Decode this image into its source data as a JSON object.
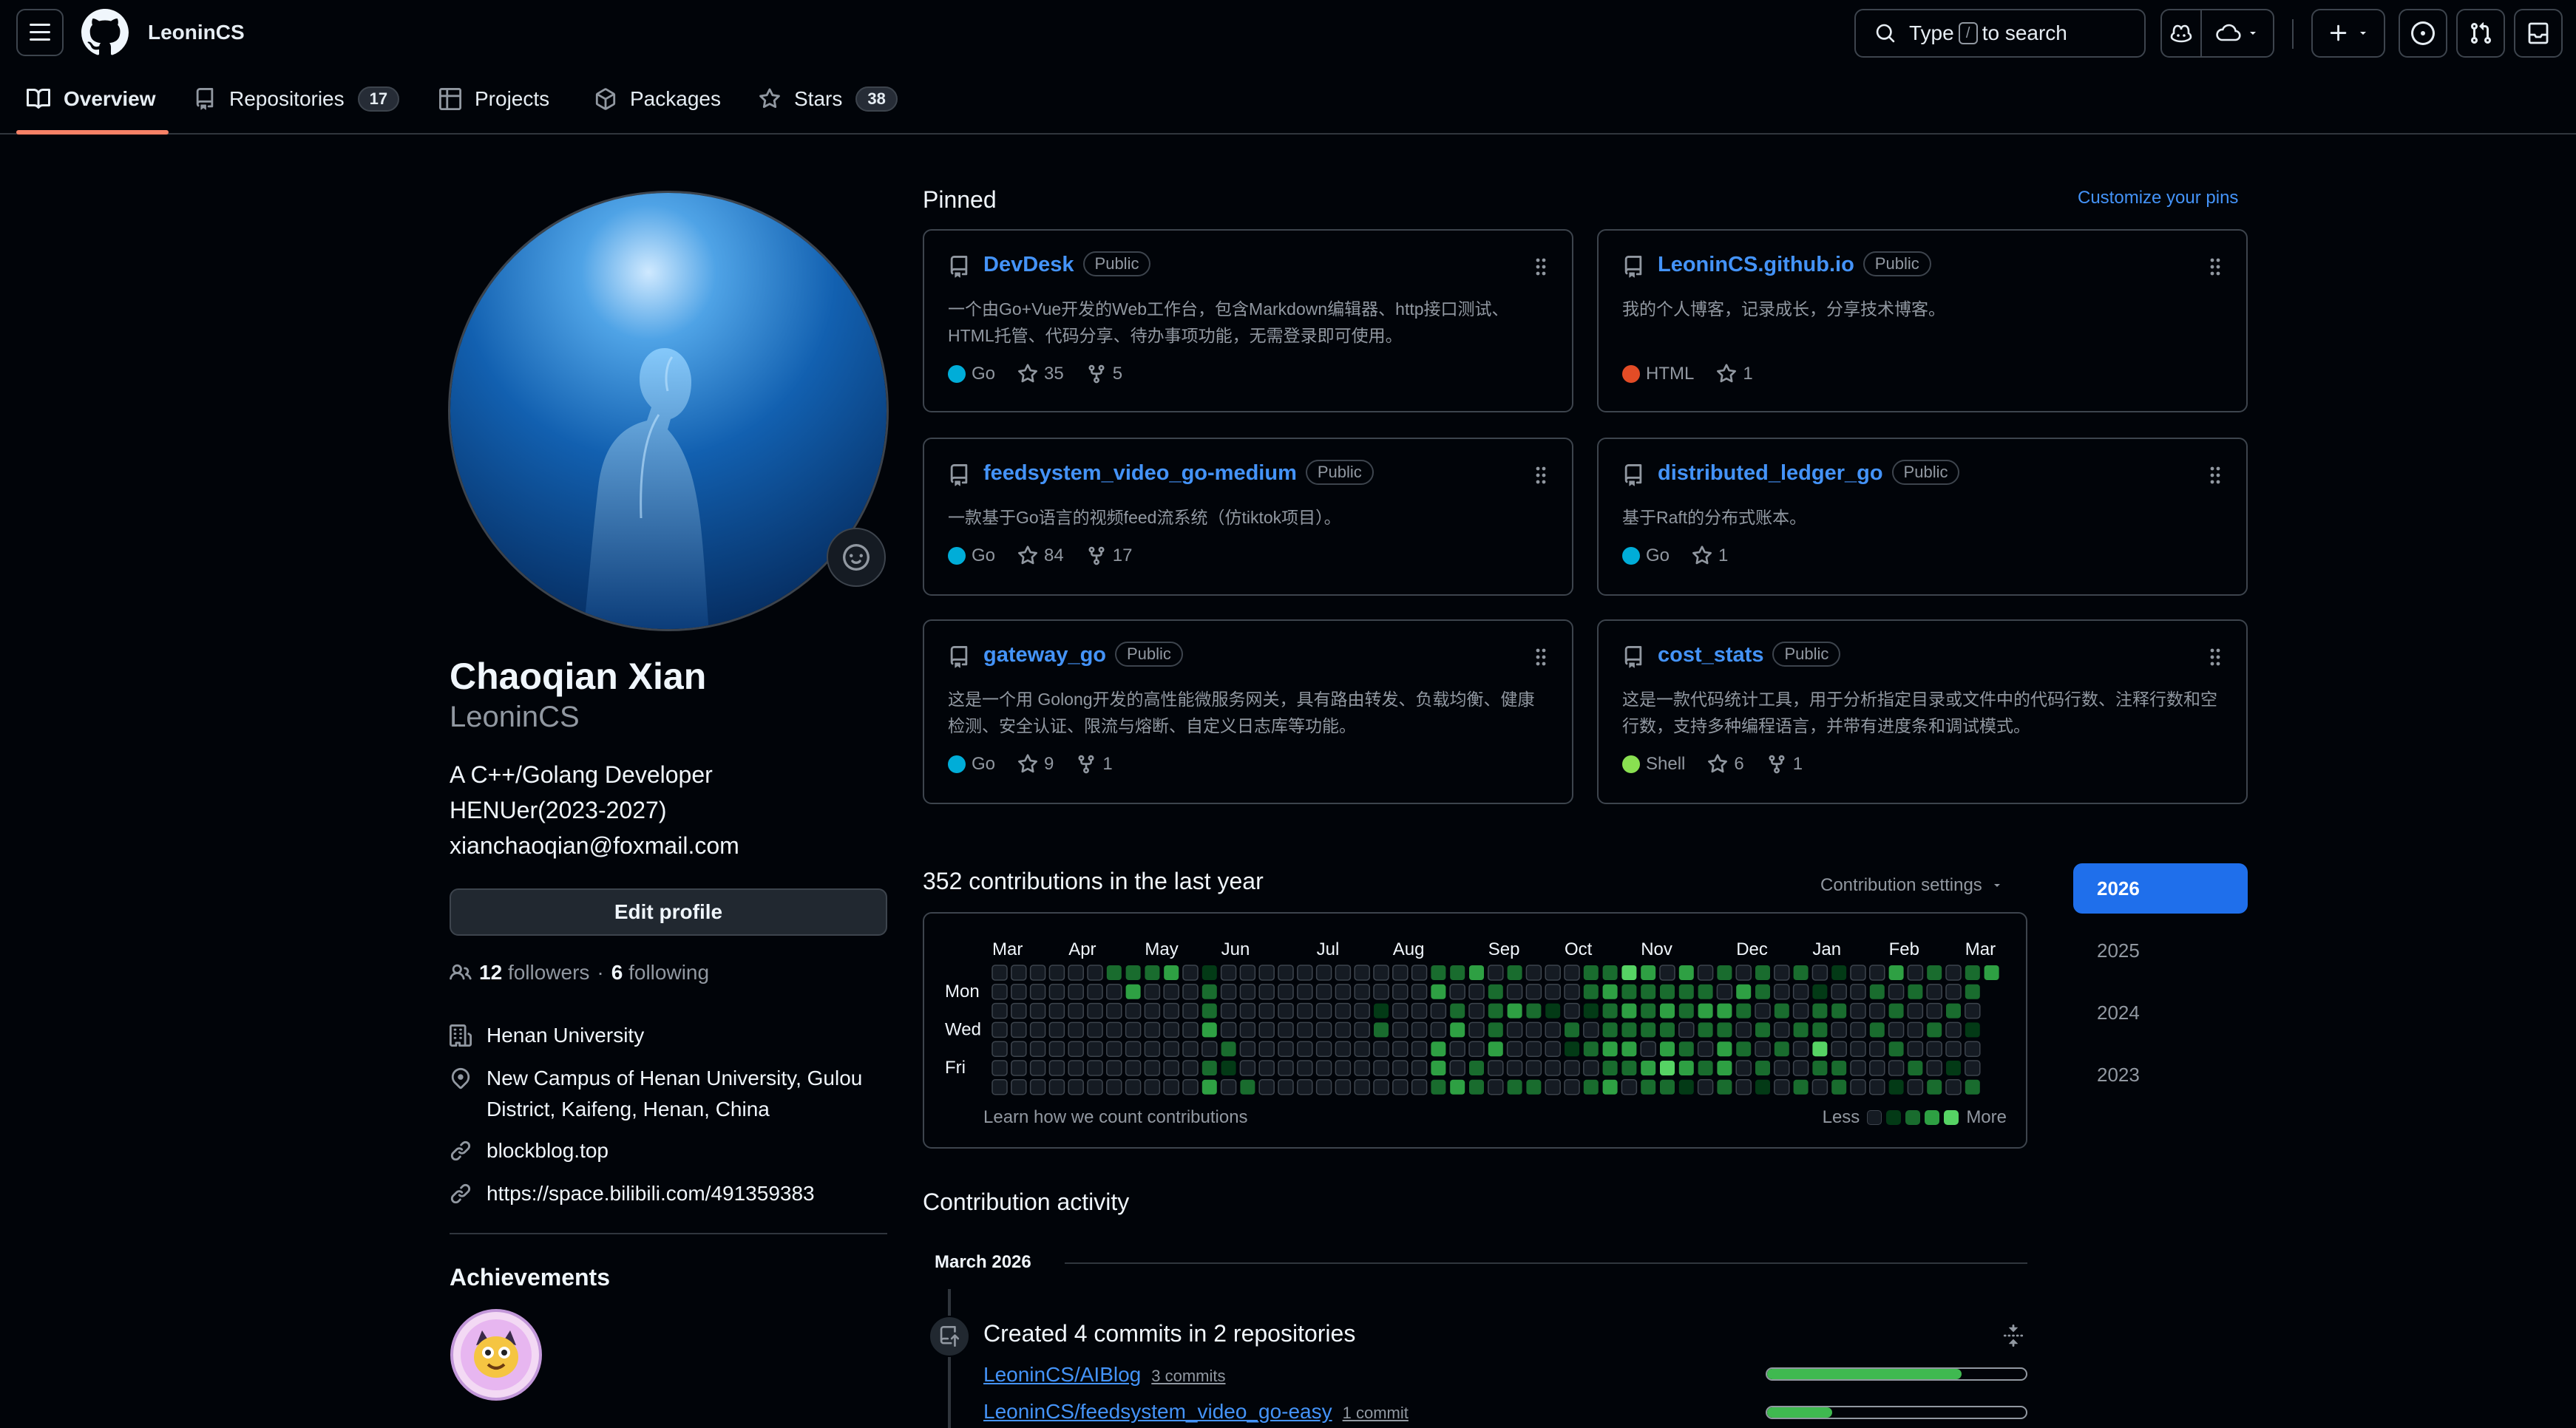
{
  "header": {
    "username": "LeoninCS",
    "search_prefix": "Type",
    "search_key": "/",
    "search_suffix": "to search"
  },
  "tabs": [
    {
      "label": "Overview",
      "count": null
    },
    {
      "label": "Repositories",
      "count": "17"
    },
    {
      "label": "Projects",
      "count": null
    },
    {
      "label": "Packages",
      "count": null
    },
    {
      "label": "Stars",
      "count": "38"
    }
  ],
  "profile": {
    "full_name": "Chaoqian Xian",
    "login": "LeoninCS",
    "bio_lines": [
      "A C++/Golang Developer",
      "HENUer(2023-2027)",
      "xianchaoqian@foxmail.com"
    ],
    "edit_label": "Edit profile",
    "followers": "12",
    "followers_label": "followers",
    "sep": "·",
    "following": "6",
    "following_label": "following",
    "organization": "Henan University",
    "location": "New Campus of Henan University, Gulou District, Kaifeng, Henan, China",
    "blog": "blockblog.top",
    "bilibili": "https://space.bilibili.com/491359383",
    "achievements_title": "Achievements"
  },
  "pinned": {
    "title": "Pinned",
    "customize": "Customize your pins",
    "repos": [
      {
        "name": "DevDesk",
        "visibility": "Public",
        "desc": "一个由Go+Vue开发的Web工作台，包含Markdown编辑器、http接口测试、HTML托管、代码分享、待办事项功能，无需登录即可使用。",
        "lang": "Go",
        "lang_color": "#00add8",
        "stars": "35",
        "forks": "5"
      },
      {
        "name": "LeoninCS.github.io",
        "visibility": "Public",
        "desc": "我的个人博客，记录成长，分享技术博客。",
        "lang": "HTML",
        "lang_color": "#e34c26",
        "stars": "1",
        "forks": null
      },
      {
        "name": "feedsystem_video_go-medium",
        "visibility": "Public",
        "desc": "一款基于Go语言的视频feed流系统（仿tiktok项目）。",
        "lang": "Go",
        "lang_color": "#00add8",
        "stars": "84",
        "forks": "17"
      },
      {
        "name": "distributed_ledger_go",
        "visibility": "Public",
        "desc": "基于Raft的分布式账本。",
        "lang": "Go",
        "lang_color": "#00add8",
        "stars": "1",
        "forks": null
      },
      {
        "name": "gateway_go",
        "visibility": "Public",
        "desc": "这是一个用 Golong开发的高性能微服务网关，具有路由转发、负载均衡、健康检测、安全认证、限流与熔断、自定义日志库等功能。",
        "lang": "Go",
        "lang_color": "#00add8",
        "stars": "9",
        "forks": "1"
      },
      {
        "name": "cost_stats",
        "visibility": "Public",
        "desc": "这是一款代码统计工具，用于分析指定目录或文件中的代码行数、注释行数和空行数，支持多种编程语言，并带有进度条和调试模式。",
        "lang": "Shell",
        "lang_color": "#89e051",
        "stars": "6",
        "forks": "1"
      }
    ]
  },
  "contributions": {
    "title": "352 contributions in the last year",
    "settings_label": "Contribution settings",
    "months": [
      "Mar",
      "Apr",
      "May",
      "Jun",
      "Jul",
      "Aug",
      "Sep",
      "Oct",
      "Nov",
      "Dec",
      "Jan",
      "Feb",
      "Mar"
    ],
    "day_labels": [
      "Mon",
      "Wed",
      "Fri"
    ],
    "learn": "Learn how we count contributions",
    "less": "Less",
    "more": "More",
    "level_colors": [
      "#151b23",
      "#033a16",
      "#196c2e",
      "#2ea043",
      "#56d364"
    ],
    "weeks": 53,
    "active_cells": [
      [
        0,
        6,
        2
      ],
      [
        0,
        7,
        2
      ],
      [
        0,
        8,
        2
      ],
      [
        1,
        7,
        3
      ],
      [
        0,
        9,
        3
      ],
      [
        0,
        11,
        1
      ],
      [
        1,
        11,
        2
      ],
      [
        2,
        11,
        2
      ],
      [
        3,
        11,
        3
      ],
      [
        5,
        11,
        2
      ],
      [
        6,
        11,
        3
      ],
      [
        4,
        12,
        2
      ],
      [
        5,
        12,
        1
      ],
      [
        6,
        13,
        2
      ],
      [
        2,
        20,
        1
      ],
      [
        3,
        20,
        2
      ],
      [
        0,
        23,
        2
      ],
      [
        1,
        23,
        3
      ],
      [
        4,
        23,
        3
      ],
      [
        5,
        23,
        3
      ],
      [
        6,
        23,
        2
      ],
      [
        0,
        24,
        2
      ],
      [
        2,
        24,
        2
      ],
      [
        3,
        24,
        3
      ],
      [
        6,
        24,
        3
      ],
      [
        0,
        25,
        3
      ],
      [
        5,
        25,
        2
      ],
      [
        6,
        25,
        2
      ],
      [
        1,
        26,
        2
      ],
      [
        2,
        26,
        2
      ],
      [
        3,
        26,
        2
      ],
      [
        4,
        26,
        3
      ],
      [
        0,
        27,
        2
      ],
      [
        2,
        27,
        3
      ],
      [
        6,
        27,
        2
      ],
      [
        2,
        28,
        2
      ],
      [
        6,
        28,
        2
      ],
      [
        2,
        29,
        1
      ],
      [
        3,
        30,
        2
      ],
      [
        4,
        30,
        1
      ],
      [
        0,
        31,
        2
      ],
      [
        1,
        31,
        2
      ],
      [
        2,
        31,
        1
      ],
      [
        4,
        31,
        2
      ],
      [
        6,
        31,
        2
      ],
      [
        0,
        32,
        2
      ],
      [
        1,
        32,
        3
      ],
      [
        2,
        32,
        2
      ],
      [
        3,
        32,
        2
      ],
      [
        4,
        32,
        3
      ],
      [
        5,
        32,
        2
      ],
      [
        6,
        32,
        3
      ],
      [
        0,
        33,
        4
      ],
      [
        1,
        33,
        2
      ],
      [
        2,
        33,
        3
      ],
      [
        3,
        33,
        2
      ],
      [
        4,
        33,
        3
      ],
      [
        5,
        33,
        2
      ],
      [
        0,
        34,
        3
      ],
      [
        1,
        34,
        2
      ],
      [
        2,
        34,
        2
      ],
      [
        3,
        34,
        2
      ],
      [
        5,
        34,
        3
      ],
      [
        6,
        34,
        2
      ],
      [
        1,
        35,
        2
      ],
      [
        2,
        35,
        3
      ],
      [
        3,
        35,
        2
      ],
      [
        4,
        35,
        3
      ],
      [
        5,
        35,
        4
      ],
      [
        6,
        35,
        2
      ],
      [
        0,
        36,
        3
      ],
      [
        1,
        36,
        2
      ],
      [
        2,
        36,
        2
      ],
      [
        4,
        36,
        2
      ],
      [
        5,
        36,
        3
      ],
      [
        6,
        36,
        1
      ],
      [
        1,
        37,
        2
      ],
      [
        2,
        37,
        3
      ],
      [
        3,
        37,
        2
      ],
      [
        5,
        37,
        2
      ],
      [
        0,
        38,
        2
      ],
      [
        2,
        38,
        3
      ],
      [
        3,
        38,
        2
      ],
      [
        4,
        38,
        3
      ],
      [
        5,
        38,
        3
      ],
      [
        6,
        38,
        2
      ],
      [
        1,
        39,
        3
      ],
      [
        2,
        39,
        2
      ],
      [
        4,
        39,
        2
      ],
      [
        0,
        40,
        2
      ],
      [
        1,
        40,
        2
      ],
      [
        3,
        40,
        2
      ],
      [
        5,
        40,
        2
      ],
      [
        6,
        40,
        1
      ],
      [
        2,
        41,
        2
      ],
      [
        4,
        41,
        2
      ],
      [
        0,
        42,
        2
      ],
      [
        3,
        42,
        2
      ],
      [
        6,
        42,
        2
      ],
      [
        1,
        43,
        1
      ],
      [
        2,
        43,
        2
      ],
      [
        3,
        43,
        2
      ],
      [
        4,
        43,
        4
      ],
      [
        5,
        43,
        2
      ],
      [
        0,
        44,
        1
      ],
      [
        2,
        44,
        2
      ],
      [
        5,
        44,
        2
      ],
      [
        6,
        44,
        2
      ],
      [
        1,
        46,
        2
      ],
      [
        3,
        46,
        2
      ],
      [
        0,
        47,
        3
      ],
      [
        2,
        47,
        2
      ],
      [
        4,
        47,
        2
      ],
      [
        6,
        47,
        1
      ],
      [
        1,
        48,
        2
      ],
      [
        5,
        48,
        2
      ],
      [
        0,
        49,
        2
      ],
      [
        3,
        49,
        2
      ],
      [
        6,
        49,
        2
      ],
      [
        2,
        50,
        2
      ],
      [
        5,
        50,
        1
      ],
      [
        0,
        51,
        2
      ],
      [
        1,
        51,
        2
      ],
      [
        3,
        51,
        1
      ],
      [
        6,
        51,
        2
      ],
      [
        0,
        52,
        3
      ]
    ],
    "years": [
      "2026",
      "2025",
      "2024",
      "2023"
    ],
    "active_year": "2026"
  },
  "activity": {
    "title": "Contribution activity",
    "month": "March 2026",
    "summary": "Created 4 commits in 2 repositories",
    "repos": [
      {
        "name": "LeoninCS/AIBlog",
        "commits": "3 commits",
        "progress": 0.75
      },
      {
        "name": "LeoninCS/feedsystem_video_go-easy",
        "commits": "1 commit",
        "progress": 0.25
      }
    ]
  }
}
